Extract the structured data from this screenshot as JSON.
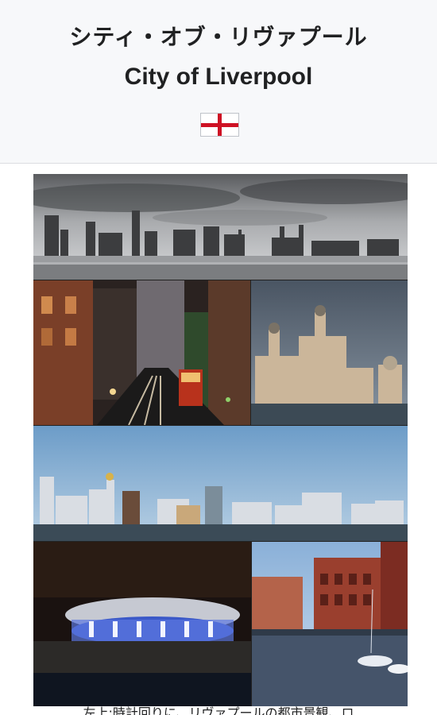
{
  "header": {
    "title_ja": "シティ・オブ・リヴァプール",
    "title_en": "City of Liverpool",
    "flag_icon": "england-flag-icon",
    "flag_colors": {
      "field": "#ffffff",
      "cross": "#ce1124"
    }
  },
  "montage": {
    "panels": [
      {
        "name": "waterfront-skyline-bw"
      },
      {
        "name": "city-street-night"
      },
      {
        "name": "royal-liver-building"
      },
      {
        "name": "waterfront-panorama-day"
      },
      {
        "name": "echo-arena-night"
      },
      {
        "name": "albert-dock"
      }
    ]
  },
  "caption": {
    "text": "左上:時計回りに、リヴァプールの都市景観、ロ"
  }
}
